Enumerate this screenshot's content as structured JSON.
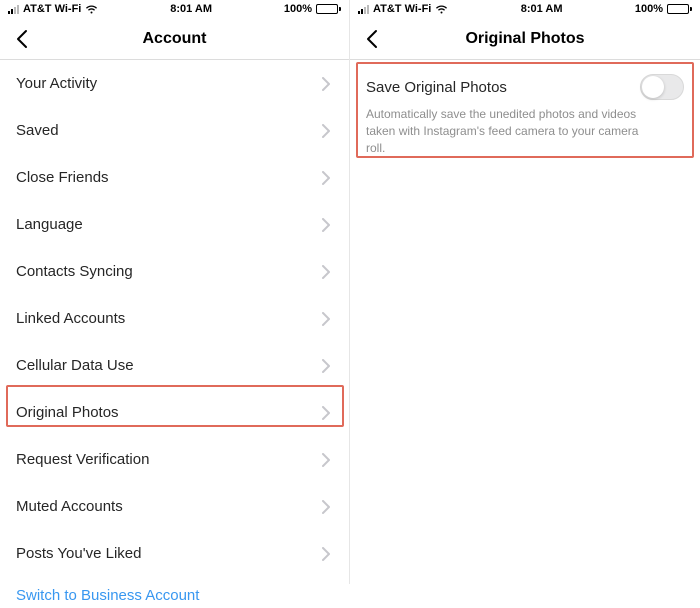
{
  "status": {
    "carrier": "AT&T Wi-Fi",
    "time": "8:01 AM",
    "battery_pct": "100%"
  },
  "left": {
    "nav_title": "Account",
    "items": [
      "Your Activity",
      "Saved",
      "Close Friends",
      "Language",
      "Contacts Syncing",
      "Linked Accounts",
      "Cellular Data Use",
      "Original Photos",
      "Request Verification",
      "Muted Accounts",
      "Posts You've Liked"
    ],
    "business_link": "Switch to Business Account"
  },
  "right": {
    "nav_title": "Original Photos",
    "setting_title": "Save Original Photos",
    "setting_desc": "Automatically save the unedited photos and videos taken with Instagram's feed camera to your camera roll.",
    "toggle_on": false
  },
  "colors": {
    "highlight_border": "#e06a5a",
    "link": "#3897f0",
    "chevron": "#c7c7cc",
    "desc": "#8e8e8e"
  }
}
